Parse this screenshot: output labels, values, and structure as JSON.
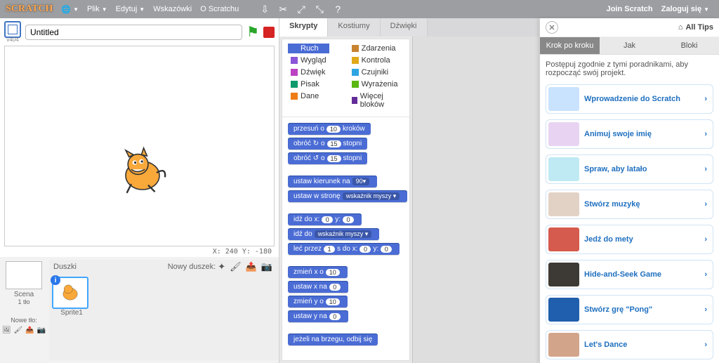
{
  "topbar": {
    "logo": "SCRATCH",
    "menus": [
      "Plik",
      "Edytuj",
      "Wskazówki",
      "O Scratchu"
    ],
    "right": {
      "join": "Join Scratch",
      "signin": "Zaloguj się"
    }
  },
  "project": {
    "title": "Untitled",
    "fs_label": "v404",
    "coords": "X: 240  Y: -180"
  },
  "sprite_panel": {
    "scene_label": "Scena",
    "scene_sub": "1 tło",
    "new_bg": "Nowe tło:",
    "header": "Duszki",
    "new_sprite": "Nowy duszek:",
    "sprite1": "Sprite1"
  },
  "tabs": {
    "scripts": "Skrypty",
    "costumes": "Kostiumy",
    "sounds": "Dźwięki"
  },
  "categories": {
    "left": [
      {
        "n": "Ruch",
        "c": "#4a6cd4"
      },
      {
        "n": "Wygląd",
        "c": "#8a55d7"
      },
      {
        "n": "Dźwięk",
        "c": "#bb42c3"
      },
      {
        "n": "Pisak",
        "c": "#0e9a6c"
      },
      {
        "n": "Dane",
        "c": "#ee7d16"
      }
    ],
    "right": [
      {
        "n": "Zdarzenia",
        "c": "#c88330"
      },
      {
        "n": "Kontrola",
        "c": "#e1a91a"
      },
      {
        "n": "Czujniki",
        "c": "#2ca5e2"
      },
      {
        "n": "Wyrażenia",
        "c": "#5cb712"
      },
      {
        "n": "Więcej bloków",
        "c": "#632d99"
      }
    ]
  },
  "blocks": {
    "b1_a": "przesuń o",
    "b1_n": "10",
    "b1_b": "kroków",
    "b2_a": "obróć ↻ o",
    "b2_n": "15",
    "b2_b": "stopni",
    "b3_a": "obróć ↺ o",
    "b3_n": "15",
    "b3_b": "stopni",
    "b4_a": "ustaw kierunek na",
    "b4_d": "90▾",
    "b5_a": "ustaw w stronę",
    "b5_d": "wskaźnik myszy ▾",
    "b6_a": "idź do x:",
    "b6_n1": "0",
    "b6_b": "y:",
    "b6_n2": "0",
    "b7_a": "idź do",
    "b7_d": "wskaźnik myszy ▾",
    "b8_a": "leć przez",
    "b8_n1": "1",
    "b8_b": "s do x:",
    "b8_n2": "0",
    "b8_c": "y:",
    "b8_n3": "0",
    "b9_a": "zmień x o",
    "b9_n": "10",
    "b10_a": "ustaw x na",
    "b10_n": "0",
    "b11_a": "zmień y o",
    "b11_n": "10",
    "b12_a": "ustaw y na",
    "b12_n": "0",
    "b13_a": "jeżeli na brzegu, odbij się"
  },
  "tips": {
    "all": "All Tips",
    "tabs": {
      "step": "Krok po kroku",
      "how": "Jak",
      "blocks": "Bloki"
    },
    "intro": "Postępuj zgodnie z tymi poradnikami, aby rozpocząć swój projekt.",
    "guides": [
      {
        "t": "Wprowadzenie do Scratch",
        "c": "#c9e3ff"
      },
      {
        "t": "Animuj swoje imię",
        "c": "#e8d4f2"
      },
      {
        "t": "Spraw, aby latało",
        "c": "#bfeaf4"
      },
      {
        "t": "Stwórz muzykę",
        "c": "#e2d2c5"
      },
      {
        "t": "Jedź do mety",
        "c": "#d45b4d"
      },
      {
        "t": "Hide-and-Seek Game",
        "c": "#3d3934"
      },
      {
        "t": "Stwórz grę \"Pong\"",
        "c": "#1f5fad"
      },
      {
        "t": "Let's Dance",
        "c": "#d2a58b"
      }
    ]
  }
}
